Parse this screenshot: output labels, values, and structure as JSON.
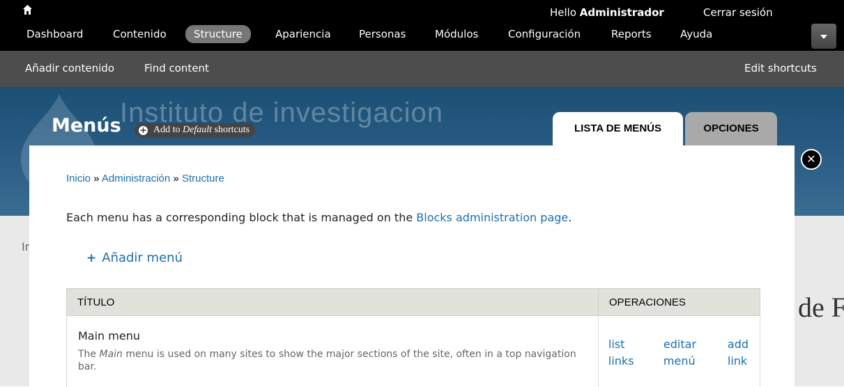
{
  "toolbar": {
    "home_icon": "home-icon",
    "hello_prefix": "Hello ",
    "username": "Administrador",
    "logout": "Cerrar sesión",
    "nav": [
      {
        "label": "Dashboard",
        "active": false
      },
      {
        "label": "Contenido",
        "active": false
      },
      {
        "label": "Structure",
        "active": true
      },
      {
        "label": "Apariencia",
        "active": false
      },
      {
        "label": "Personas",
        "active": false
      },
      {
        "label": "Módulos",
        "active": false
      },
      {
        "label": "Configuración",
        "active": false
      },
      {
        "label": "Reports",
        "active": false
      },
      {
        "label": "Ayuda",
        "active": false
      }
    ],
    "toggle_icon": "chevron-down-icon"
  },
  "shortcuts": {
    "items": [
      "Añadir contenido",
      "Find content"
    ],
    "edit": "Edit shortcuts"
  },
  "header": {
    "site_name": "Instituto de investigacion",
    "page_title": "Menús",
    "shortcut_prefix": "Add to ",
    "shortcut_set": "Default",
    "shortcut_suffix": " shortcuts",
    "tabs": [
      {
        "label": "LISTA DE MENÚS",
        "active": true
      },
      {
        "label": "OPCIONES",
        "active": false
      }
    ]
  },
  "behind": {
    "left_text": "In",
    "right_text": "de F"
  },
  "overlay": {
    "close_icon": "close-icon",
    "breadcrumb": [
      "Inicio",
      "Administración",
      "Structure"
    ],
    "breadcrumb_sep": " » ",
    "help_prefix": "Each menu has a corresponding block that is managed on the ",
    "help_link": "Blocks administration page",
    "help_suffix": ".",
    "add_menu_icon": "+",
    "add_menu": "Añadir menú",
    "table": {
      "columns": [
        "TÍTULO",
        "OPERACIONES"
      ],
      "rows": [
        {
          "title": "Main menu",
          "desc_prefix": "The ",
          "desc_em": "Main",
          "desc_suffix": " menu is used on many sites to show the major sections of the site, often in a top navigation bar.",
          "ops": [
            {
              "line1": "list",
              "line2": "links"
            },
            {
              "line1": "editar",
              "line2": "menú"
            },
            {
              "line1": "add",
              "line2": "link"
            }
          ]
        }
      ]
    }
  },
  "colors": {
    "toolbar_bg": "#000000",
    "shortcuts_bg": "#4d4d4d",
    "link": "#1a6fb0",
    "active_nav": "#777777"
  }
}
